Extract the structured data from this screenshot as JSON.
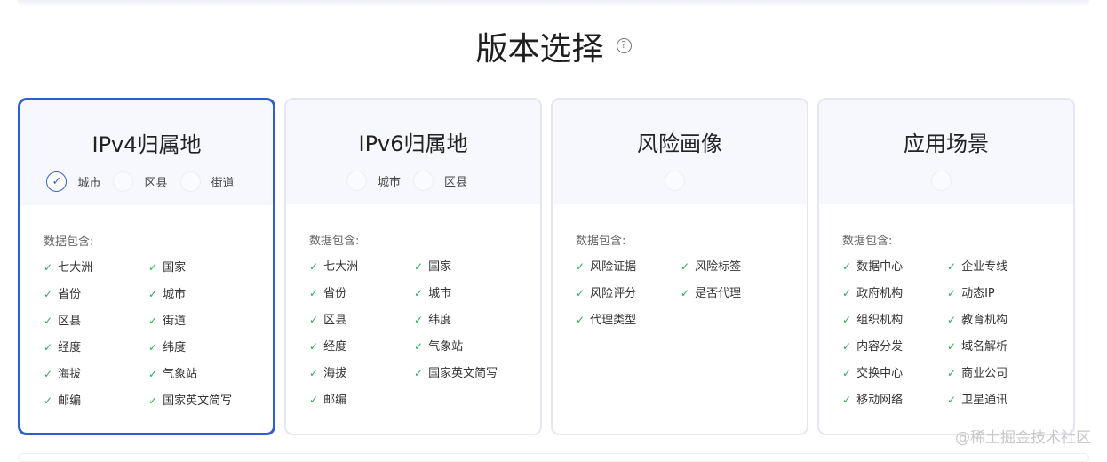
{
  "page": {
    "title": "版本选择",
    "help_icon": "?",
    "watermark": "@稀土掘金技术社区"
  },
  "colors": {
    "accent": "#2e5fcc",
    "check": "#2fae5a"
  },
  "cards": [
    {
      "title": "IPv4归属地",
      "selected": true,
      "options": [
        {
          "label": "城市",
          "checked": true
        },
        {
          "label": "区县",
          "checked": false
        },
        {
          "label": "街道",
          "checked": false
        }
      ],
      "includes_label": "数据包含:",
      "items": [
        "七大洲",
        "国家",
        "省份",
        "城市",
        "区县",
        "街道",
        "经度",
        "纬度",
        "海拔",
        "气象站",
        "邮编",
        "国家英文简写"
      ]
    },
    {
      "title": "IPv6归属地",
      "selected": false,
      "options": [
        {
          "label": "城市",
          "checked": false
        },
        {
          "label": "区县",
          "checked": false
        }
      ],
      "includes_label": "数据包含:",
      "items": [
        "七大洲",
        "国家",
        "省份",
        "城市",
        "区县",
        "纬度",
        "经度",
        "气象站",
        "海拔",
        "国家英文简写",
        "邮编"
      ]
    },
    {
      "title": "风险画像",
      "selected": false,
      "options": [
        {
          "label": "",
          "checked": false
        }
      ],
      "includes_label": "数据包含:",
      "items": [
        "风险证据",
        "风险标签",
        "风险评分",
        "是否代理",
        "代理类型"
      ]
    },
    {
      "title": "应用场景",
      "selected": false,
      "options": [
        {
          "label": "",
          "checked": false
        }
      ],
      "includes_label": "数据包含:",
      "items": [
        "数据中心",
        "企业专线",
        "政府机构",
        "动态IP",
        "组织机构",
        "教育机构",
        "内容分发",
        "域名解析",
        "交换中心",
        "商业公司",
        "移动网络",
        "卫星通讯"
      ]
    }
  ]
}
